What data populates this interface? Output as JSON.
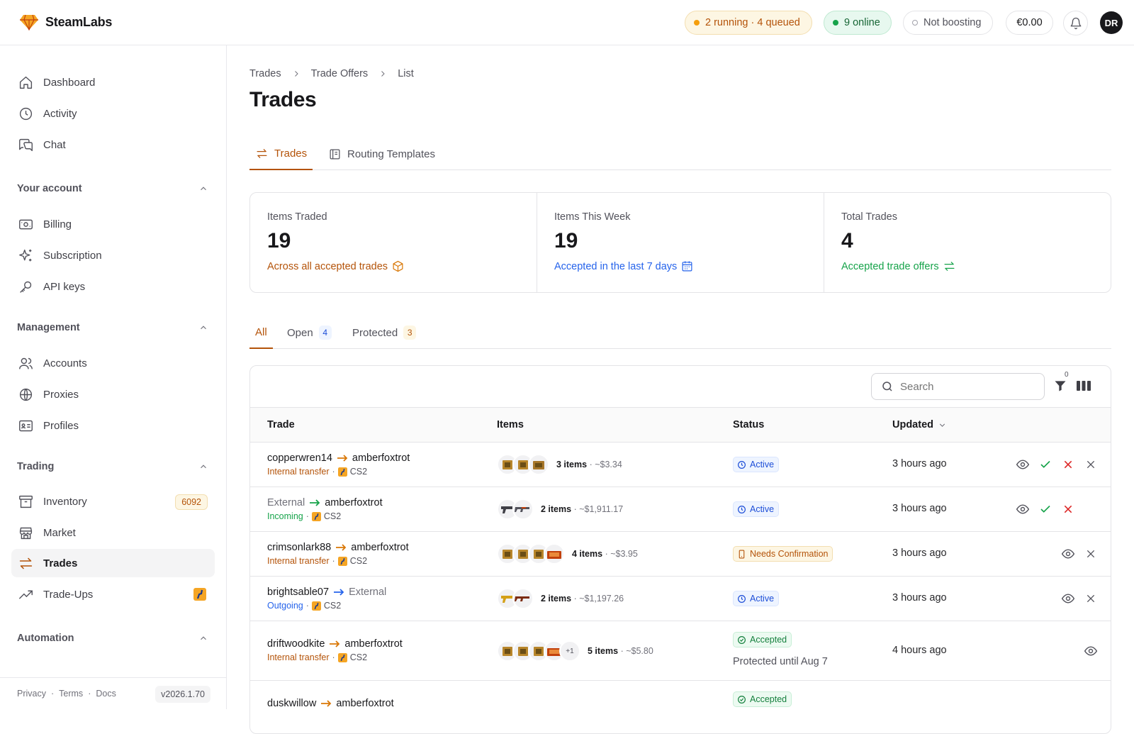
{
  "app": {
    "name": "SteamLabs"
  },
  "topbar": {
    "jobs": "2 running · 4 queued",
    "online": "9 online",
    "boost": "Not boosting",
    "balance": "€0.00",
    "avatar_initials": "DR"
  },
  "sidebar": {
    "primary": [
      {
        "label": "Dashboard",
        "icon": "home-icon"
      },
      {
        "label": "Activity",
        "icon": "clock-icon"
      },
      {
        "label": "Chat",
        "icon": "chat-icon"
      }
    ],
    "sections": [
      {
        "title": "Your account",
        "items": [
          {
            "label": "Billing",
            "icon": "billing-icon"
          },
          {
            "label": "Subscription",
            "icon": "sparkles-icon"
          },
          {
            "label": "API keys",
            "icon": "key-icon"
          }
        ]
      },
      {
        "title": "Management",
        "items": [
          {
            "label": "Accounts",
            "icon": "users-icon"
          },
          {
            "label": "Proxies",
            "icon": "globe-icon"
          },
          {
            "label": "Profiles",
            "icon": "id-card-icon"
          }
        ]
      },
      {
        "title": "Trading",
        "items": [
          {
            "label": "Inventory",
            "icon": "archive-icon",
            "badge": "6092"
          },
          {
            "label": "Market",
            "icon": "store-icon"
          },
          {
            "label": "Trades",
            "icon": "swap-icon",
            "active": true
          },
          {
            "label": "Trade-Ups",
            "icon": "trending-up-icon"
          }
        ]
      },
      {
        "title": "Automation",
        "items": []
      }
    ],
    "footer": {
      "privacy": "Privacy",
      "terms": "Terms",
      "docs": "Docs",
      "version": "v2026.1.70"
    }
  },
  "breadcrumb": [
    "Trades",
    "Trade Offers",
    "List"
  ],
  "page_title": "Trades",
  "main_tabs": [
    {
      "label": "Trades",
      "active": true
    },
    {
      "label": "Routing Templates"
    }
  ],
  "stats": [
    {
      "label": "Items Traded",
      "value": "19",
      "sub": "Across all accepted trades",
      "color": "#b45309"
    },
    {
      "label": "Items This Week",
      "value": "19",
      "sub": "Accepted in the last 7 days",
      "color": "#2563eb"
    },
    {
      "label": "Total Trades",
      "value": "4",
      "sub": "Accepted trade offers",
      "color": "#16a34a"
    }
  ],
  "filter_tabs": [
    {
      "label": "All",
      "active": true
    },
    {
      "label": "Open",
      "count": "4"
    },
    {
      "label": "Protected",
      "count": "3"
    }
  ],
  "search": {
    "placeholder": "Search"
  },
  "filter_count": "0",
  "table": {
    "columns": [
      "Trade",
      "Items",
      "Status",
      "Updated"
    ],
    "rows": [
      {
        "from": "copperwren14",
        "to": "amberfoxtrot",
        "kind": "Internal transfer",
        "game": "CS2",
        "items_count": "3 items",
        "value": "~$3.34",
        "status": "Active",
        "updated": "3 hours ago"
      },
      {
        "from": "External",
        "to": "amberfoxtrot",
        "kind": "Incoming",
        "game": "CS2",
        "items_count": "2 items",
        "value": "~$1,911.17",
        "status": "Active",
        "updated": "3 hours ago"
      },
      {
        "from": "crimsonlark88",
        "to": "amberfoxtrot",
        "kind": "Internal transfer",
        "game": "CS2",
        "items_count": "4 items",
        "value": "~$3.95",
        "status": "Needs Confirmation",
        "updated": "3 hours ago"
      },
      {
        "from": "brightsable07",
        "to": "External",
        "kind": "Outgoing",
        "game": "CS2",
        "items_count": "2 items",
        "value": "~$1,197.26",
        "status": "Active",
        "updated": "3 hours ago"
      },
      {
        "from": "driftwoodkite",
        "to": "amberfoxtrot",
        "kind": "Internal transfer",
        "game": "CS2",
        "items_count": "5 items",
        "value": "~$5.80",
        "more": "+1",
        "status": "Accepted",
        "protected": "Protected until Aug 7",
        "updated": "4 hours ago"
      },
      {
        "from": "duskwillow",
        "to": "amberfoxtrot",
        "status": "Accepted"
      }
    ]
  }
}
